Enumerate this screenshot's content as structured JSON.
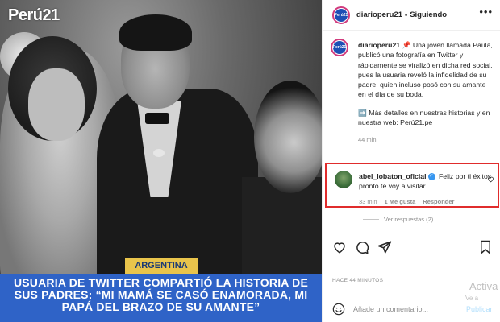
{
  "photo": {
    "brand": "Perú21",
    "tag": "ARGENTINA",
    "headline": "USUARIA DE TWITTER COMPARTIÓ LA HISTORIA DE SUS PADRES: “MI MAMÁ SE CASÓ ENAMORADA, MI PAPÁ DEL BRAZO DE SU AMANTE”"
  },
  "header": {
    "avatar_text": "Perú21",
    "username": "diarioperu21",
    "separator": "•",
    "follow_status": "Siguiendo",
    "more": "•••"
  },
  "caption": {
    "username": "diarioperu21",
    "emoji": "📌",
    "text": "Una joven llamada Paula, publicó una fotografía en Twitter y rápidamente se viralizó en dicha red social, pues la usuaria reveló la infidelidad de su padre, quien incluso posó con su amante en el día de su boda.",
    "link_text": "➡️ Más detalles en nuestras historias y en nuestra web: Perú21.pe",
    "time": "44 min"
  },
  "comment": {
    "username": "abel_lobaton_oficial",
    "verified": "✓",
    "text": "Feliz por ti éxitos pronto te voy a visitar",
    "time": "33 min",
    "likes": "1 Me gusta",
    "reply": "Responder",
    "view_replies": "Ver respuestas (2)"
  },
  "post": {
    "posted_ago": "HACE 44 MINUTOS"
  },
  "add_comment": {
    "placeholder": "Añade un comentario...",
    "publish": "Publicar"
  },
  "watermark": {
    "line1": "Activa",
    "line2": "Ve a"
  },
  "colors": {
    "headline_bg": "#2f63c7",
    "tag_bg": "#e9c44b",
    "highlight_border": "#e02c2c",
    "verified": "#3897f0",
    "publish": "#b2dffc"
  }
}
